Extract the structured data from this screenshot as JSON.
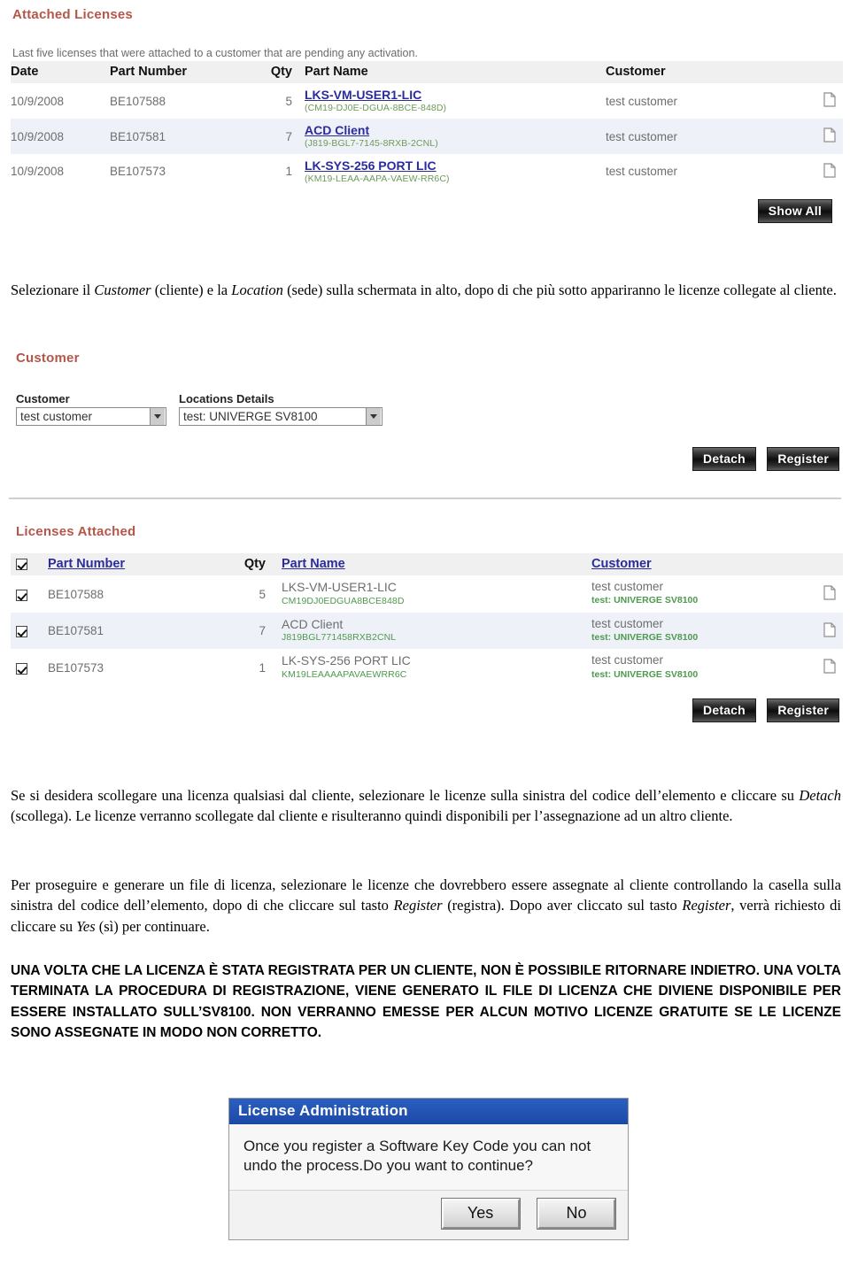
{
  "screenshot_top": {
    "title": "Attached Licenses",
    "hint": "Last five licenses that were attached to a customer that are pending any activation.",
    "columns": [
      "Date",
      "Part Number",
      "Qty",
      "Part Name",
      "Customer"
    ],
    "rows": [
      {
        "date": "10/9/2008",
        "part_number": "BE107588",
        "qty": "5",
        "part_name": "LKS-VM-USER1-LIC",
        "key_code": "(CM19-DJ0E-DGUA-8BCE-848D)",
        "customer": "test customer",
        "doc_icon": "document-icon"
      },
      {
        "date": "10/9/2008",
        "part_number": "BE107581",
        "qty": "7",
        "part_name": "ACD Client",
        "key_code": "(J819-BGL7-7145-8RXB-2CNL)",
        "customer": "test customer",
        "doc_icon": "document-icon"
      },
      {
        "date": "10/9/2008",
        "part_number": "BE107573",
        "qty": "1",
        "part_name": "LK-SYS-256 PORT LIC",
        "key_code": "(KM19-LEAA-AAPA-VAEW-RR6C)",
        "customer": "test customer",
        "doc_icon": "document-icon"
      }
    ],
    "show_all_label": "Show All"
  },
  "caption_1": {
    "pre": "Selezionare il ",
    "em1": "Customer",
    "mid": " (cliente) e la ",
    "em2": "Location",
    "post": " (sede) sulla schermata in alto, dopo di che più sotto appariranno le licenze collegate al cliente."
  },
  "screenshot_middle": {
    "title": "Customer",
    "customer_label": "Customer",
    "customer_value": "test customer",
    "locations_label": "Locations Details",
    "locations_value": "test: UNIVERGE SV8100",
    "detach_label": "Detach",
    "register_label": "Register"
  },
  "screenshot_bottom": {
    "title": "Licenses Attached",
    "columns": [
      "",
      "Part Number",
      "Qty",
      "Part Name",
      "Customer"
    ],
    "header_checkbox_checked": true,
    "rows": [
      {
        "checked": true,
        "part_number": "BE107588",
        "qty": "5",
        "part_name": "LKS-VM-USER1-LIC",
        "key_code": "CM19DJ0EDGUA8BCE848D",
        "customer": "test customer",
        "location": "test: UNIVERGE SV8100",
        "doc_icon": "document-icon"
      },
      {
        "checked": true,
        "part_number": "BE107581",
        "qty": "7",
        "part_name": "ACD Client",
        "key_code": "J819BGL771458RXB2CNL",
        "customer": "test customer",
        "location": "test: UNIVERGE SV8100",
        "doc_icon": "document-icon"
      },
      {
        "checked": true,
        "part_number": "BE107573",
        "qty": "1",
        "part_name": "LK-SYS-256 PORT LIC",
        "key_code": "KM19LEAAAAPAVAEWRR6C",
        "customer": "test customer",
        "location": "test: UNIVERGE SV8100",
        "doc_icon": "document-icon"
      }
    ],
    "detach_label": "Detach",
    "register_label": "Register"
  },
  "paragraph_detach": {
    "p1": "Se si desidera scollegare una licenza qualsiasi dal cliente, selezionare le licenze sulla sinistra del codice dell’elemento e cliccare su ",
    "em1": "Detach",
    "p2": " (scollega).  Le licenze verranno scollegate dal cliente e risulteranno quindi disponibili per l’assegnazione ad un altro cliente."
  },
  "paragraph_register": {
    "p1": "Per proseguire e generare un file di licenza, selezionare le licenze che dovrebbero essere assegnate al cliente controllando la casella sulla sinistra del codice dell’elemento, dopo di che cliccare sul tasto ",
    "em1": "Register",
    "p2": " (registra).  Dopo aver cliccato sul tasto ",
    "em2": "Register",
    "p3": ", verrà richiesto di cliccare su ",
    "em3": "Yes",
    "p4": " (sì) per continuare."
  },
  "paragraph_warning": {
    "text": "UNA VOLTA CHE LA LICENZA È STATA REGISTRATA PER UN CLIENTE, NON È POSSIBILE RITORNARE INDIETRO.   UNA VOLTA TERMINATA LA PROCEDURA DI REGISTRAZIONE, VIENE GENERATO IL FILE DI LICENZA CHE DIVIENE DISPONIBILE PER ESSERE INSTALLATO SULL’SV8100.  NON VERRANNO EMESSE PER ALCUN MOTIVO LICENZE GRATUITE SE LE LICENZE SONO ASSEGNATE IN MODO NON CORRETTO."
  },
  "dialog": {
    "title": "License Administration",
    "message": "Once you register a Software Key Code you can not undo the process.Do you want to continue?",
    "yes_label": "Yes",
    "no_label": "No"
  },
  "colors": {
    "section_heading": "#b5564a",
    "link": "#2b2b9e",
    "key_code_green": "#6f9a58",
    "dialog_title_blue": "#1d49a6",
    "row_alt": "#eef2f8",
    "button_dark": "#1a1a1a"
  }
}
